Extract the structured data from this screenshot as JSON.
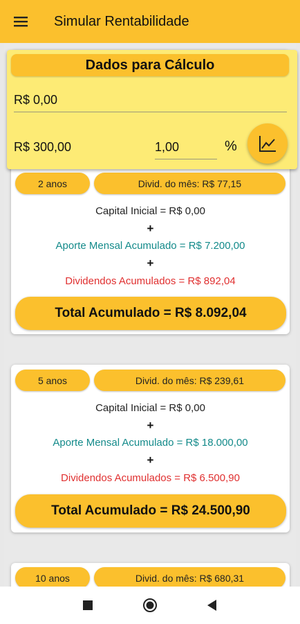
{
  "appbar": {
    "title": "Simular Rentabilidade"
  },
  "form": {
    "header": "Dados para Cálculo",
    "initial_capital": "R$ 0,00",
    "monthly_contribution": "R$ 300,00",
    "rate": "1,00",
    "rate_unit": "%",
    "chart_button_icon": "trending-up-icon"
  },
  "cards": [
    {
      "period": "2 anos",
      "monthly_dividend": "Divid. do mês: R$ 77,15",
      "capital": "Capital Inicial = R$ 0,00",
      "plus1": "+",
      "aporte": "Aporte Mensal Acumulado = R$ 7.200,00",
      "plus2": "+",
      "dividends": "Dividendos Acumulados = R$ 892,04",
      "total": "Total Acumulado = R$ 8.092,04"
    },
    {
      "period": "5 anos",
      "monthly_dividend": "Divid. do mês: R$ 239,61",
      "capital": "Capital Inicial = R$ 0,00",
      "plus1": "+",
      "aporte": "Aporte Mensal Acumulado = R$ 18.000,00",
      "plus2": "+",
      "dividends": "Dividendos Acumulados = R$ 6.500,90",
      "total": "Total Acumulado = R$ 24.500,90"
    },
    {
      "period": "10 anos",
      "monthly_dividend": "Divid. do mês: R$ 680,31"
    }
  ],
  "colors": {
    "accent": "#fbc02d",
    "form_background": "#fdeb75",
    "aporte_text": "#138a8a",
    "dividend_text": "#e03030"
  },
  "navbar": {
    "icons": [
      "recents-square-icon",
      "home-circle-icon",
      "back-triangle-icon"
    ]
  }
}
